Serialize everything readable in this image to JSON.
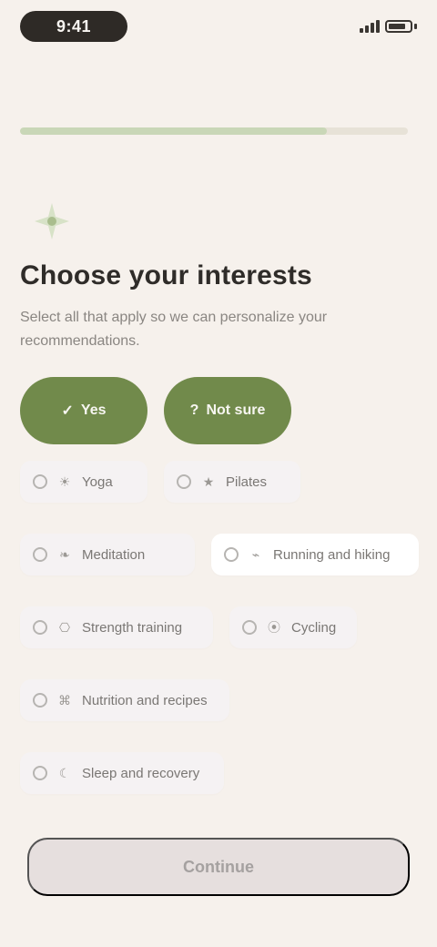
{
  "status": {
    "time": "9:41"
  },
  "progress": {
    "value": 0.79
  },
  "page": {
    "title": "Choose your interests",
    "subtitle": "Select all that apply so we can personalize your recommendations.",
    "choices": [
      {
        "label": "Yes"
      },
      {
        "label": "Not sure"
      }
    ],
    "chips": [
      {
        "label": "Yoga",
        "icon": "sun-icon"
      },
      {
        "label": "Pilates",
        "icon": "star-icon"
      },
      {
        "label": "Meditation",
        "icon": "leaf-icon"
      },
      {
        "label": "Running and hiking",
        "icon": "shoe-icon"
      },
      {
        "label": "Strength training",
        "icon": "dumbbell-icon"
      },
      {
        "label": "Cycling",
        "icon": "bike-icon"
      },
      {
        "label": "Nutrition and recipes",
        "icon": "apple-icon"
      },
      {
        "label": "Sleep and recovery",
        "icon": "moon-icon"
      }
    ],
    "cta": "Continue"
  }
}
